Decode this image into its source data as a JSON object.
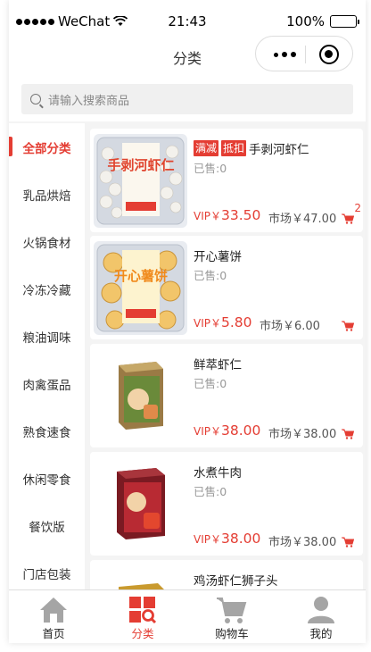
{
  "status_bar": {
    "carrier": "WeChat",
    "time": "21:43",
    "battery": "100%"
  },
  "nav": {
    "title": "分类"
  },
  "search": {
    "placeholder": "请输入搜索商品"
  },
  "sidebar": {
    "items": [
      {
        "label": "全部分类",
        "active": true
      },
      {
        "label": "乳品烘焙"
      },
      {
        "label": "火锅食材"
      },
      {
        "label": "冷冻冷藏"
      },
      {
        "label": "粮油调味"
      },
      {
        "label": "肉禽蛋品"
      },
      {
        "label": "熟食速食"
      },
      {
        "label": "休闲零食"
      },
      {
        "label": "餐饮版"
      },
      {
        "label": "门店包装"
      }
    ]
  },
  "products": [
    {
      "tags": [
        "满减",
        "抵扣"
      ],
      "name": "手剥河虾仁",
      "sold": "已售:0",
      "vip_prefix": "VIP￥",
      "vip_price": "33.50",
      "market": "市场￥47.00",
      "cart_count": "2"
    },
    {
      "tags": [],
      "name": "开心薯饼",
      "sold": "已售:0",
      "vip_prefix": "VIP￥",
      "vip_price": "5.80",
      "market": "市场￥6.00",
      "cart_count": ""
    },
    {
      "tags": [],
      "name": "鲜萃虾仁",
      "sold": "已售:0",
      "vip_prefix": "VIP￥",
      "vip_price": "38.00",
      "market": "市场￥38.00",
      "cart_count": ""
    },
    {
      "tags": [],
      "name": "水煮牛肉",
      "sold": "已售:0",
      "vip_prefix": "VIP￥",
      "vip_price": "38.00",
      "market": "市场￥38.00",
      "cart_count": ""
    },
    {
      "tags": [],
      "name": "鸡汤虾仁狮子头",
      "sold": "",
      "vip_prefix": "",
      "vip_price": "",
      "market": "",
      "cart_count": ""
    }
  ],
  "package_text": {
    "p1": "手剥河虾仁",
    "p2": "开心薯饼"
  },
  "tabbar": {
    "items": [
      {
        "label": "首页",
        "icon": "home-icon"
      },
      {
        "label": "分类",
        "icon": "category-icon",
        "active": true
      },
      {
        "label": "购物车",
        "icon": "cart-icon"
      },
      {
        "label": "我的",
        "icon": "user-icon"
      }
    ]
  },
  "colors": {
    "accent": "#e43d33",
    "tab_inactive": "#a5a5a5"
  }
}
